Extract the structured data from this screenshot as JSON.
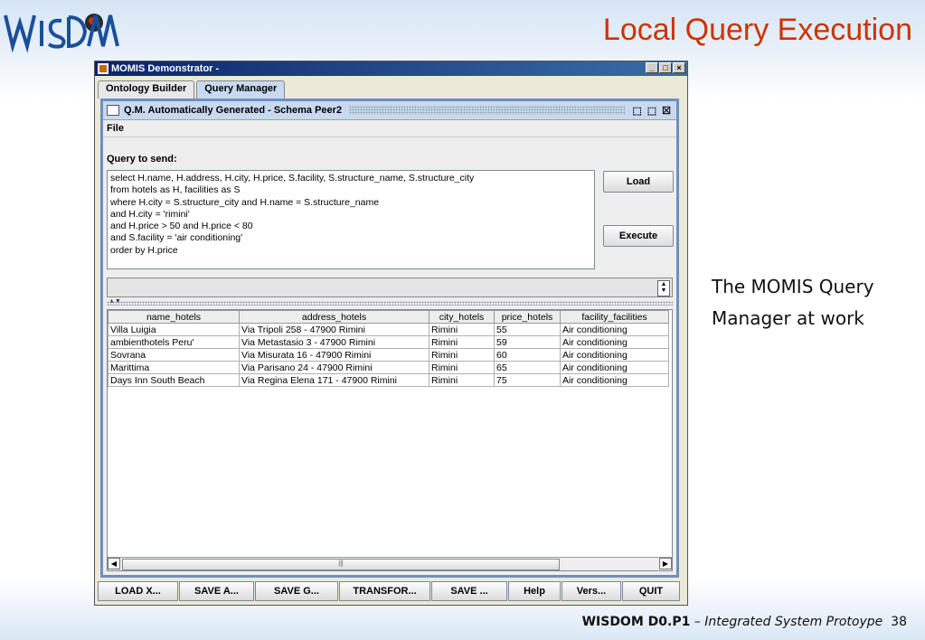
{
  "slide": {
    "title": "Local Query Execution",
    "caption_line1": "The MOMIS Query",
    "caption_line2": "Manager at work",
    "footer_bold": "WISDOM D0.P1",
    "footer_sep": " – ",
    "footer_italic": "Integrated System Protoype",
    "page_number": "38",
    "logo_text": "WISDOM"
  },
  "window": {
    "title": "MOMIS Demonstrator -",
    "min_label": "_",
    "max_label": "□",
    "close_label": "×"
  },
  "tabs": [
    {
      "label": "Ontology Builder"
    },
    {
      "label": "Query Manager"
    }
  ],
  "inner_frame": {
    "title": "Q.M. Automatically Generated - Schema Peer2",
    "menu_file": "File",
    "query_label": "Query to send:",
    "query_text": "select H.name, H.address, H.city, H.price, S.facility, S.structure_name, S.structure_city\nfrom hotels as H, facilities as S\nwhere H.city = S.structure_city and H.name = S.structure_name\nand H.city = 'rimini'\nand H.price > 50 and H.price < 80\nand S.facility = 'air conditioning'\norder by H.price",
    "load_label": "Load",
    "execute_label": "Execute"
  },
  "results": {
    "columns": [
      "name_hotels",
      "address_hotels",
      "city_hotels",
      "price_hotels",
      "facility_facilities"
    ],
    "rows": [
      [
        "Villa Luigia",
        "Via Tripoli 258 - 47900 Rimini",
        "Rimini",
        "55",
        "Air conditioning"
      ],
      [
        "ambienthotels Peru'",
        "Via Metastasio 3 - 47900 Rimini",
        "Rimini",
        "59",
        "Air conditioning"
      ],
      [
        "Sovrana",
        "Via Misurata 16 - 47900 Rimini",
        "Rimini",
        "60",
        "Air conditioning"
      ],
      [
        "Marittima",
        "Via Parisano 24 - 47900 Rimini",
        "Rimini",
        "65",
        "Air conditioning"
      ],
      [
        "Days Inn South Beach",
        "Via Regina Elena 171 - 47900 Rimini",
        "Rimini",
        "75",
        "Air conditioning"
      ]
    ]
  },
  "bottom_buttons": [
    {
      "label": "LOAD X..."
    },
    {
      "label": "SAVE A..."
    },
    {
      "label": "SAVE G..."
    },
    {
      "label": "TRANSFOR..."
    },
    {
      "label": "SAVE ..."
    },
    {
      "label": "Help"
    },
    {
      "label": "Vers..."
    },
    {
      "label": "QUIT"
    }
  ],
  "colors": {
    "title_red": "#cc3300",
    "frame_blue": "#6f8fc0"
  }
}
